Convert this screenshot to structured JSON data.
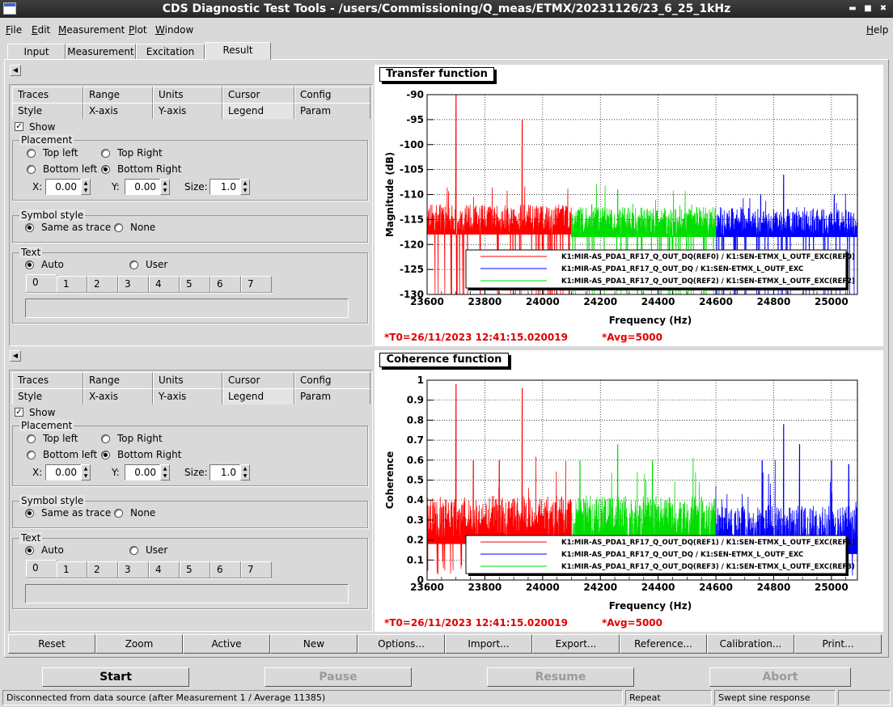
{
  "window": {
    "title": "CDS Diagnostic Test Tools - /users/Commissioning/Q_meas/ETMX/20231126/23_6_25_1kHz",
    "min_icon": "minimize-icon",
    "max_icon": "maximize-icon",
    "close_icon": "close-icon"
  },
  "menu": {
    "items": [
      "File",
      "Edit",
      "Measurement",
      "Plot",
      "Window"
    ],
    "help": "Help"
  },
  "main_tabs": [
    "Input",
    "Measurement",
    "Excitation",
    "Result"
  ],
  "main_tabs_active": 3,
  "panels": [
    {
      "subtabs_row1": [
        "Traces",
        "Range",
        "Units",
        "Cursor",
        "Config"
      ],
      "subtabs_row2": [
        "Style",
        "X-axis",
        "Y-axis",
        "Legend",
        "Param"
      ],
      "active_subtab": "Legend",
      "show_label": "Show",
      "placement_label": "Placement",
      "top_left": "Top left",
      "top_right": "Top Right",
      "bottom_left": "Bottom left",
      "bottom_right": "Bottom Right",
      "x_label": "X:",
      "x_value": "0.00",
      "y_label": "Y:",
      "y_value": "0.00",
      "size_label": "Size:",
      "size_value": "1.0",
      "symbol_label": "Symbol style",
      "same_as_trace": "Same as trace",
      "none": "None",
      "text_label": "Text",
      "auto": "Auto",
      "user": "User",
      "num_tabs": [
        "0",
        "1",
        "2",
        "3",
        "4",
        "5",
        "6",
        "7"
      ]
    },
    {
      "subtabs_row1": [
        "Traces",
        "Range",
        "Units",
        "Cursor",
        "Config"
      ],
      "subtabs_row2": [
        "Style",
        "X-axis",
        "Y-axis",
        "Legend",
        "Param"
      ],
      "active_subtab": "Legend",
      "show_label": "Show",
      "placement_label": "Placement",
      "top_left": "Top left",
      "top_right": "Top Right",
      "bottom_left": "Bottom left",
      "bottom_right": "Bottom Right",
      "x_label": "X:",
      "x_value": "0.00",
      "y_label": "Y:",
      "y_value": "0.00",
      "size_label": "Size:",
      "size_value": "1.0",
      "symbol_label": "Symbol style",
      "same_as_trace": "Same as trace",
      "none": "None",
      "text_label": "Text",
      "auto": "Auto",
      "user": "User",
      "num_tabs": [
        "0",
        "1",
        "2",
        "3",
        "4",
        "5",
        "6",
        "7"
      ]
    }
  ],
  "chart_data": [
    {
      "type": "line",
      "title": "Transfer function",
      "xlabel": "Frequency (Hz)",
      "ylabel": "Magnitude (dB)",
      "xlim": [
        23600,
        25090
      ],
      "ylim": [
        -130,
        -90
      ],
      "xticks": [
        23600,
        23800,
        24000,
        24200,
        24400,
        24600,
        24800,
        25000
      ],
      "yticks": [
        -90,
        -95,
        -100,
        -105,
        -110,
        -115,
        -120,
        -125,
        -130
      ],
      "grid": true,
      "legend_position": "bottom-right",
      "series": [
        {
          "name": "K1:MIR-AS_PDA1_RF17_Q_OUT_DQ(REF0) / K1:SEN-ETMX_L_OUTF_EXC(REF0)",
          "color": "#ff0000",
          "x_range": [
            23600,
            24100
          ],
          "baseline": -115,
          "peaks": [
            [
              23700,
              -90
            ],
            [
              23930,
              -95
            ],
            [
              23645,
              -112
            ]
          ]
        },
        {
          "name": "K1:MIR-AS_PDA1_RF17_Q_OUT_DQ / K1:SEN-ETMX_L_OUTF_EXC",
          "color": "#0000ff",
          "x_range": [
            24600,
            25090
          ],
          "baseline": -115.5,
          "peaks": [
            [
              24835,
              -106
            ],
            [
              24755,
              -110
            ],
            [
              25010,
              -110
            ]
          ]
        },
        {
          "name": "K1:MIR-AS_PDA1_RF17_Q_OUT_DQ(REF2) / K1:SEN-ETMX_L_OUTF_EXC(REF2)",
          "color": "#00dd00",
          "x_range": [
            24100,
            24600
          ],
          "baseline": -115.5,
          "peaks": [
            [
              24260,
              -109
            ],
            [
              24170,
              -112
            ]
          ]
        }
      ],
      "footer_t0": "*T0=26/11/2023 12:41:15.020019",
      "footer_avg": "*Avg=5000"
    },
    {
      "type": "line",
      "title": "Coherence function",
      "xlabel": "Frequency (Hz)",
      "ylabel": "Coherence",
      "xlim": [
        23600,
        25090
      ],
      "ylim": [
        0,
        1
      ],
      "xticks": [
        23600,
        23800,
        24000,
        24200,
        24400,
        24600,
        24800,
        25000
      ],
      "yticks": [
        1,
        0.9,
        0.8,
        0.7,
        0.6,
        0.5,
        0.4,
        0.3,
        0.2,
        0.1,
        0
      ],
      "grid": true,
      "legend_position": "bottom-right",
      "series": [
        {
          "name": "K1:MIR-AS_PDA1_RF17_Q_OUT_DQ(REF1) / K1:SEN-ETMX_L_OUTF_EXC(REF1)",
          "color": "#ff0000",
          "x_range": [
            23600,
            24100
          ],
          "baseline": 0.3,
          "peaks": [
            [
              23700,
              0.98
            ],
            [
              23930,
              0.96
            ],
            [
              23760,
              0.6
            ],
            [
              23850,
              0.6
            ]
          ]
        },
        {
          "name": "K1:MIR-AS_PDA1_RF17_Q_OUT_DQ / K1:SEN-ETMX_L_OUTF_EXC",
          "color": "#0000ff",
          "x_range": [
            24600,
            25090
          ],
          "baseline": 0.25,
          "peaks": [
            [
              24835,
              0.78
            ],
            [
              24890,
              0.68
            ],
            [
              24760,
              0.6
            ],
            [
              25000,
              0.6
            ],
            [
              25060,
              0.58
            ]
          ]
        },
        {
          "name": "K1:MIR-AS_PDA1_RF17_Q_OUT_DQ(REF3) / K1:SEN-ETMX_L_OUTF_EXC(REF3)",
          "color": "#00dd00",
          "x_range": [
            24100,
            24600
          ],
          "baseline": 0.3,
          "peaks": [
            [
              24260,
              0.68
            ],
            [
              24130,
              0.6
            ],
            [
              24380,
              0.6
            ]
          ]
        }
      ],
      "footer_t0": "*T0=26/11/2023 12:41:15.020019",
      "footer_avg": "*Avg=5000"
    }
  ],
  "toolbar": [
    "Reset",
    "Zoom",
    "Active",
    "New",
    "Options...",
    "Import...",
    "Export...",
    "Reference...",
    "Calibration...",
    "Print..."
  ],
  "controls": {
    "start": "Start",
    "pause": "Pause",
    "resume": "Resume",
    "abort": "Abort"
  },
  "status": {
    "message": "Disconnected from data source (after Measurement 1 / Average 11385)",
    "mode": "Repeat",
    "type": "Swept sine response"
  }
}
